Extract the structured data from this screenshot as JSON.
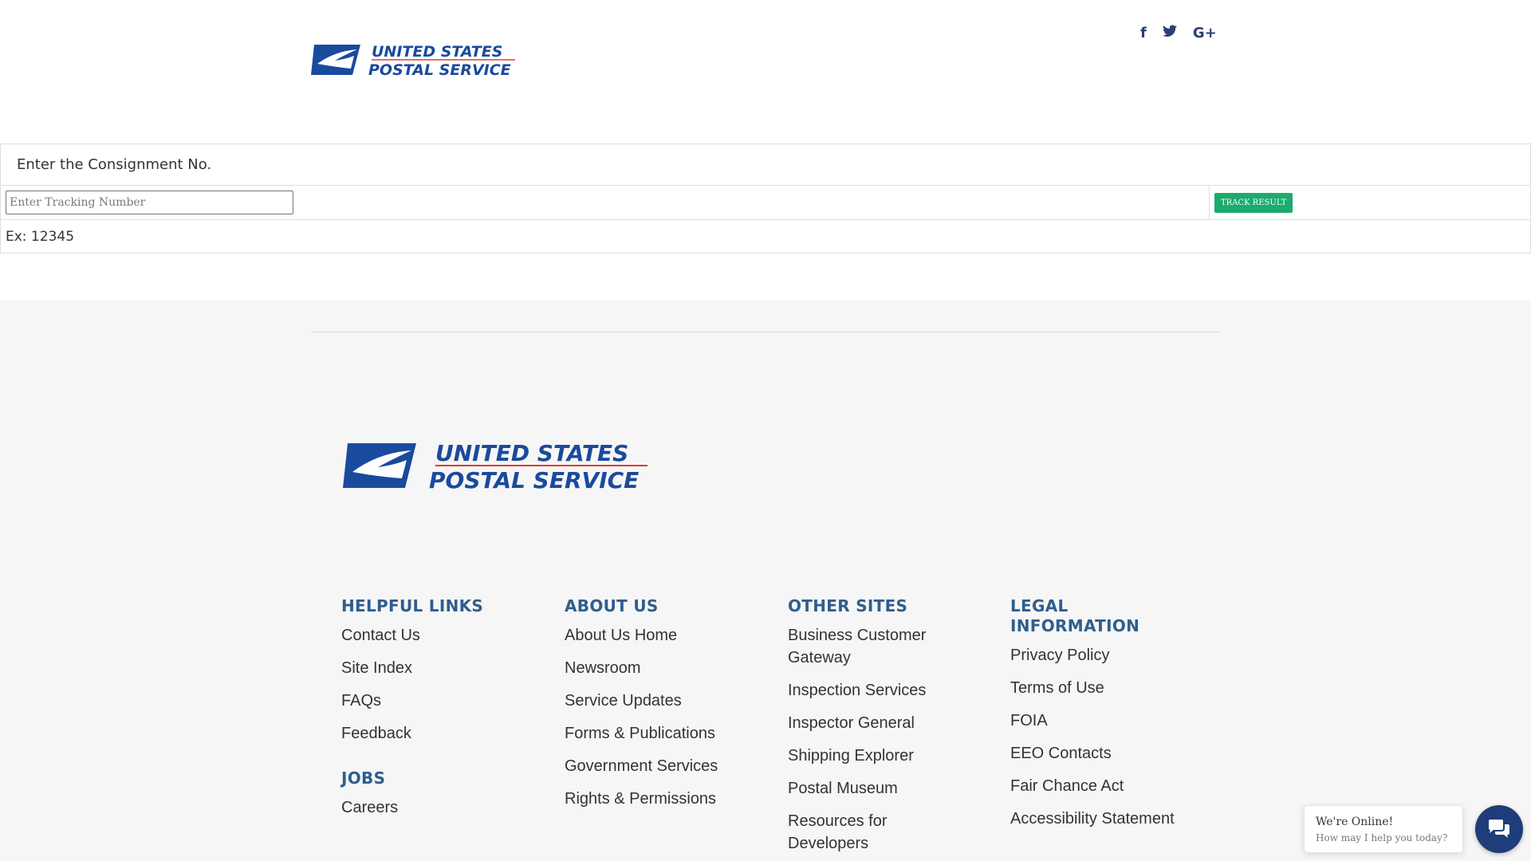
{
  "brand": {
    "logo_line1": "UNITED STATES",
    "logo_line2": "POSTAL SERVICE",
    "primary_color": "#1a4a9c",
    "accent_color": "#e03b2e"
  },
  "social": [
    {
      "icon": "facebook-icon",
      "glyph": "f"
    },
    {
      "icon": "twitter-icon",
      "glyph": "🐦"
    },
    {
      "icon": "google-plus-icon",
      "glyph": "G+"
    }
  ],
  "tracking": {
    "title": "Enter the Consignment No.",
    "input_placeholder": "Enter Tracking Number",
    "input_value": "",
    "button_label": "TRACK RESULT",
    "example": "Ex: 12345"
  },
  "footer": {
    "columns": [
      {
        "heading": "HELPFUL LINKS",
        "links": [
          "Contact Us",
          "Site Index",
          "FAQs",
          "Feedback"
        ],
        "sub_heading": "JOBS",
        "sub_links": [
          "Careers"
        ]
      },
      {
        "heading": "ABOUT US",
        "links": [
          "About Us Home",
          "Newsroom",
          "Service Updates",
          "Forms & Publications",
          "Government Services",
          "Rights & Permissions"
        ]
      },
      {
        "heading": "OTHER SITES",
        "links": [
          "Business Customer Gateway",
          "Inspection Services",
          "Inspector General",
          "Shipping Explorer",
          "Postal Museum",
          "Resources for Developers"
        ]
      },
      {
        "heading": "LEGAL INFORMATION",
        "links": [
          "Privacy Policy",
          "Terms of Use",
          "FOIA",
          "EEO Contacts",
          "Fair Chance Act",
          "Accessibility Statement"
        ]
      }
    ]
  },
  "chat": {
    "title": "We're Online!",
    "subtitle": "How may I help you today?"
  }
}
